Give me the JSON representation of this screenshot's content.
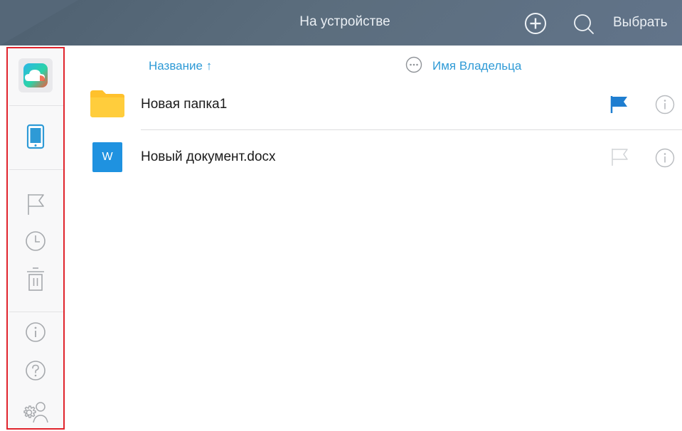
{
  "header": {
    "title": "На устройстве",
    "select_label": "Выбрать"
  },
  "sidebar": {
    "items": [
      {
        "icon": "cloud-icon"
      },
      {
        "icon": "device-icon",
        "active": true
      },
      {
        "icon": "flag-icon"
      },
      {
        "icon": "clock-icon"
      },
      {
        "icon": "trash-icon"
      },
      {
        "icon": "info-icon"
      },
      {
        "icon": "help-icon"
      },
      {
        "icon": "settings-user-icon"
      }
    ]
  },
  "columns": {
    "name_label": "Название",
    "sort_arrow": "↑",
    "owner_label": "Имя Владельца"
  },
  "files": [
    {
      "name": "Новая папка1",
      "type": "folder",
      "flagged": true
    },
    {
      "name": "Новый документ.docx",
      "type": "word-document",
      "doc_letter": "W",
      "flagged": false
    }
  ],
  "colors": {
    "topbar": "#5b6d7d",
    "accent": "#2e9ad6",
    "folder": "#ffc12c",
    "word": "#1f92e0",
    "sidebar_highlight": "#e0242c"
  }
}
